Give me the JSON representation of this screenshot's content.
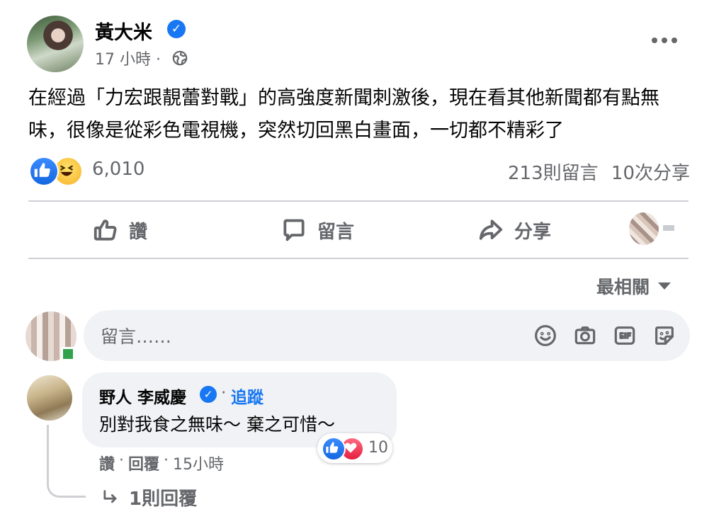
{
  "post": {
    "author": "黃大米",
    "time": "17 小時",
    "dot": "·",
    "text": "在經過「力宏跟靚蕾對戰」的高強度新聞刺激後，現在看其他新聞都有點無味，很像是從彩色電視機，突然切回黑白畫面，一切都不精彩了",
    "reaction_count": "6,010",
    "comments_count": "213則留言",
    "shares_count": "10次分享"
  },
  "actions": {
    "like": "讚",
    "comment": "留言",
    "share": "分享"
  },
  "sort": {
    "label": "最相關"
  },
  "composer": {
    "placeholder": "留言……"
  },
  "comment": {
    "author": "野人 李威慶",
    "dot": "·",
    "follow": "追蹤",
    "text": "別對我食之無味～ 棄之可惜～",
    "reaction_count": "10",
    "like": "讚",
    "reply": "回覆",
    "time": "15小時",
    "sep": "·",
    "replies": "1則回覆"
  },
  "icons": {
    "verified": "verified-badge-icon",
    "globe": "globe-icon",
    "more": "more-options-icon",
    "like": "thumbs-up-icon",
    "comment": "speech-bubble-icon",
    "share": "share-arrow-icon",
    "emoji": "emoji-icon",
    "camera": "camera-icon",
    "gif": "gif-icon",
    "sticker": "sticker-icon",
    "reply_arrow": "reply-arrow-icon"
  },
  "colors": {
    "brand": "#1877f2",
    "text_secondary": "#65676b",
    "bubble": "#f0f2f5",
    "love": "#e41e3f"
  }
}
